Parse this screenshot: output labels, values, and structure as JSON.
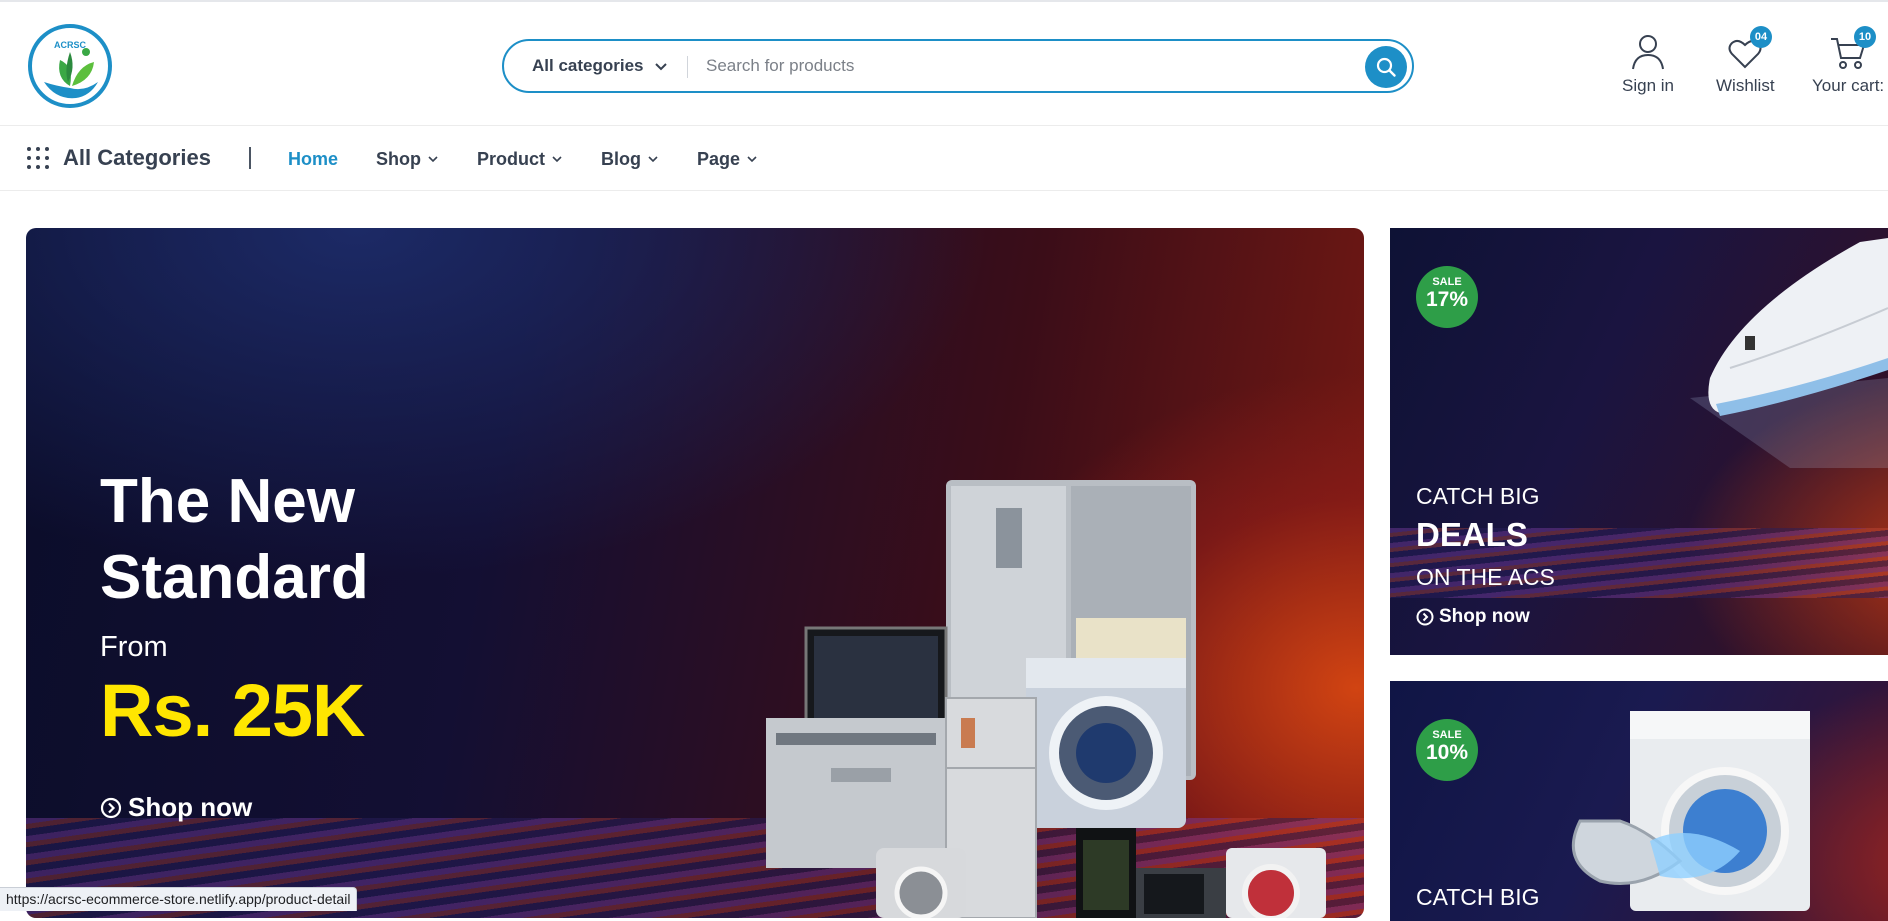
{
  "header": {
    "logo_text": "ACRSC",
    "search": {
      "category_label": "All categories",
      "placeholder": "Search for products"
    },
    "actions": {
      "signin_label": "Sign in",
      "wishlist_label": "Wishlist",
      "wishlist_count": "04",
      "cart_label": "Your cart:",
      "cart_count": "10"
    }
  },
  "nav": {
    "all_categories_label": "All Categories",
    "items": [
      {
        "label": "Home",
        "active": true
      },
      {
        "label": "Shop"
      },
      {
        "label": "Product"
      },
      {
        "label": "Blog"
      },
      {
        "label": "Page"
      }
    ]
  },
  "hero": {
    "headline_line1": "The New",
    "headline_line2": "Standard",
    "from_label": "From",
    "price": "Rs. 25K",
    "cta": "Shop now"
  },
  "side_banners": [
    {
      "sale_label": "SALE",
      "sale_percent": "17%",
      "line1": "CATCH BIG",
      "line2": "DEALS",
      "line3": "ON THE ACS",
      "cta": "Shop now"
    },
    {
      "sale_label": "SALE",
      "sale_percent": "10%",
      "line1": "CATCH BIG"
    }
  ],
  "status_url": "https://acrsc-ecommerce-store.netlify.app/product-detail",
  "colors": {
    "accent": "#1d8fc7",
    "sale_badge": "#2e9e48",
    "price_yellow": "#ffe600"
  }
}
